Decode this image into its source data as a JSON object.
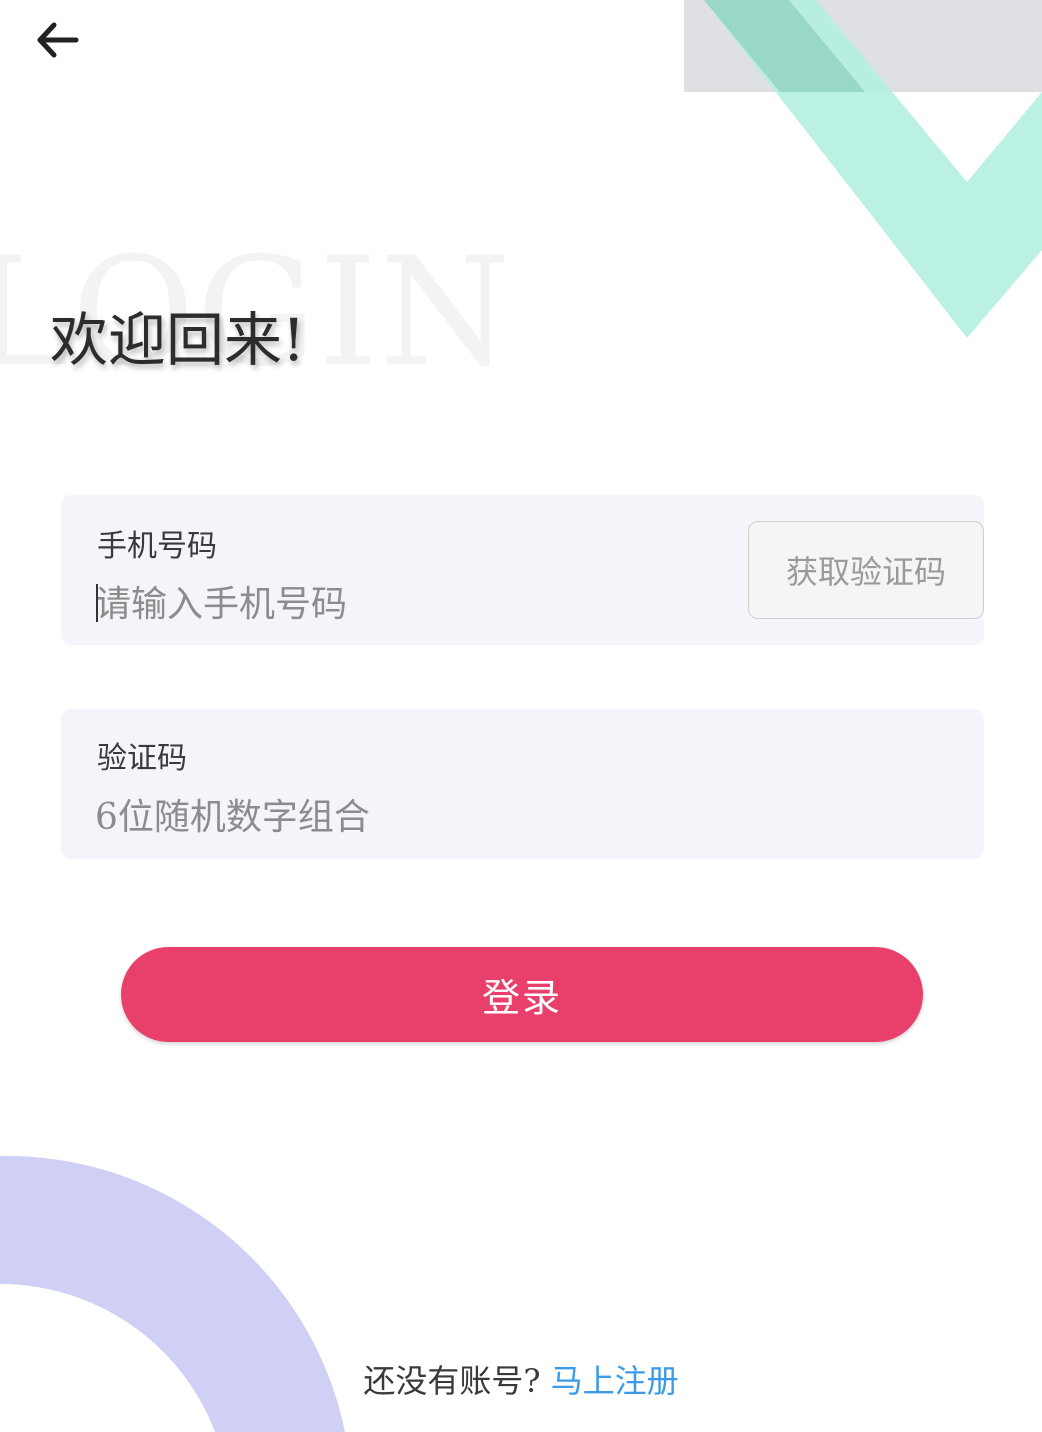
{
  "nav": {
    "back_icon": "arrow-left-icon"
  },
  "header": {
    "watermark": "LOGIN",
    "title": "欢迎回来!"
  },
  "form": {
    "phone": {
      "label": "手机号码",
      "placeholder": "请输入手机号码",
      "value": "",
      "get_code_label": "获取验证码"
    },
    "code": {
      "label": "验证码",
      "placeholder": "6位随机数字组合",
      "value": ""
    },
    "submit_label": "登录"
  },
  "footer": {
    "prompt": "还没有账号?",
    "register_link": "马上注册"
  },
  "colors": {
    "accent": "#e8406b",
    "link": "#3a9be8",
    "field_bg": "#f6f4fb",
    "decor_mint": "#b3f0e0",
    "decor_gray": "#dfe0e3",
    "decor_lavender": "#d0d0f7"
  }
}
